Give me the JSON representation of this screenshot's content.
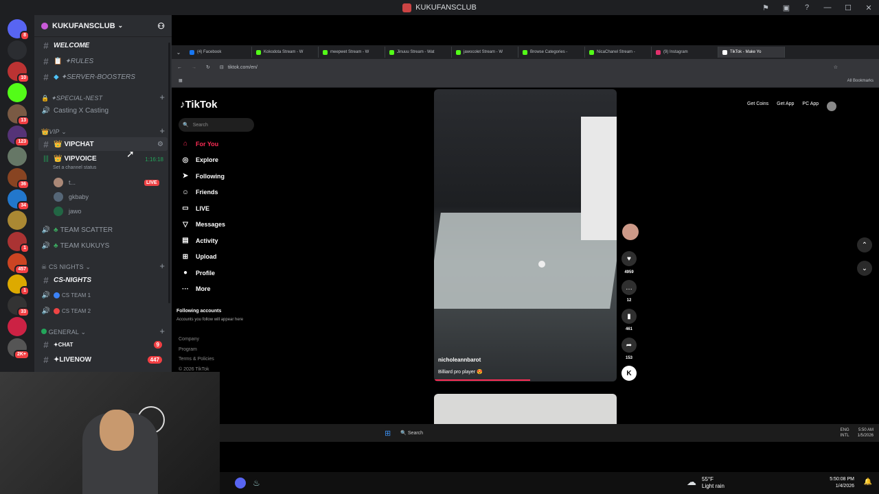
{
  "window": {
    "title": "KUKUFANSCLUB"
  },
  "server": {
    "name": "KUKUFANSCLUB"
  },
  "servers": [
    {
      "badge": "8",
      "color": "#5865f2"
    },
    {
      "badge": "",
      "color": "#2b2d31"
    },
    {
      "badge": "10",
      "color": "#b33"
    },
    {
      "badge": "",
      "color": "#53fc18"
    },
    {
      "badge": "13",
      "color": "#7a5a44"
    },
    {
      "badge": "123",
      "color": "#553377"
    },
    {
      "badge": "",
      "color": "#667766"
    },
    {
      "badge": "36",
      "color": "#884422"
    },
    {
      "badge": "34",
      "color": "#2277cc"
    },
    {
      "badge": "",
      "color": "#aa8833"
    },
    {
      "badge": "1",
      "color": "#aa3333"
    },
    {
      "badge": "457",
      "color": "#cc4422"
    },
    {
      "badge": "1",
      "color": "#ddaa00"
    },
    {
      "badge": "33",
      "color": "#333333"
    },
    {
      "badge": "",
      "color": "#cc2244"
    },
    {
      "badge": "2K+",
      "color": "#555555"
    }
  ],
  "channels": {
    "welcome": "WELCOME",
    "rules": "✦RULES",
    "boosters": "✦SERVER-BOOSTERS",
    "special_nest": "✦Special-Nest",
    "casting": "Casting X Casting",
    "vip_cat": "VIP",
    "vipchat": "VIPCHAT",
    "vipvoice": "VIPVOICE",
    "vipvoice_time": "1:16:18",
    "vipvoice_status": "Set a channel status",
    "users": [
      {
        "name": "t...",
        "live": "LIVE",
        "color": "#aa8877"
      },
      {
        "name": "gkbaby",
        "live": "",
        "color": "#556677"
      },
      {
        "name": "jawo",
        "live": "",
        "color": "#226644"
      }
    ],
    "team_scatter": "TEAM SCATTER",
    "team_kukuys": "TEAM KUKUYS",
    "cs_cat": "CS NIGHTS",
    "cs_nights": "CS-NIGHTS",
    "cs_team1": "CS TEAM 1",
    "cs_team2": "CS TEAM 2",
    "general_cat": "GENERAL",
    "chat": "✦CHAT",
    "chat_badge": "9",
    "livenow": "✦LIVENOW",
    "livenow_badge": "447"
  },
  "browser": {
    "tabs": [
      {
        "label": "(4) Facebook",
        "color": "#1877f2"
      },
      {
        "label": "Kokodota Stream - W",
        "color": "#53fc18"
      },
      {
        "label": "meepwet Stream - W",
        "color": "#53fc18"
      },
      {
        "label": "Jinuuu Stream - Wat",
        "color": "#53fc18"
      },
      {
        "label": "jawocolet Stream - W",
        "color": "#53fc18"
      },
      {
        "label": "Browse Categories -",
        "color": "#53fc18"
      },
      {
        "label": "NicaChanel Stream -",
        "color": "#53fc18"
      },
      {
        "label": "(9) Instagram",
        "color": "#e1306c"
      },
      {
        "label": "TikTok - Make Yo",
        "color": "#ffffff"
      }
    ],
    "url": "tiktok.com/en/",
    "all_bookmarks": "All Bookmarks"
  },
  "tiktok": {
    "logo": "TikTok",
    "search_placeholder": "Search",
    "nav": [
      {
        "label": "For You",
        "icon": "home-icon",
        "glyph": "⌂",
        "active": true
      },
      {
        "label": "Explore",
        "icon": "compass-icon",
        "glyph": "◎",
        "active": false
      },
      {
        "label": "Following",
        "icon": "following-icon",
        "glyph": "➤",
        "active": false
      },
      {
        "label": "Friends",
        "icon": "friends-icon",
        "glyph": "☺",
        "active": false
      },
      {
        "label": "LIVE",
        "icon": "live-icon",
        "glyph": "▭",
        "active": false
      },
      {
        "label": "Messages",
        "icon": "messages-icon",
        "glyph": "▽",
        "active": false
      },
      {
        "label": "Activity",
        "icon": "activity-icon",
        "glyph": "▤",
        "active": false
      },
      {
        "label": "Upload",
        "icon": "upload-icon",
        "glyph": "⊞",
        "active": false
      },
      {
        "label": "Profile",
        "icon": "profile-icon",
        "glyph": "●",
        "active": false
      },
      {
        "label": "More",
        "icon": "more-icon",
        "glyph": "···",
        "active": false
      }
    ],
    "following_title": "Following accounts",
    "following_sub": "Accounts you follow will appear here",
    "footer": [
      "Company",
      "Program",
      "Terms & Policies",
      "© 2026 TikTok"
    ],
    "get_coins": "Get Coins",
    "get_app": "Get App",
    "pc_app": "PC App",
    "video": {
      "author": "nicholeannbarot",
      "caption": "Billiard pro player 😍"
    },
    "likes": "4959",
    "comments": "12",
    "saves": "461",
    "shares": "153"
  },
  "inner_taskbar": {
    "search": "Search",
    "lang1": "ENG",
    "lang2": "INTL",
    "time": "5:50 AM",
    "date": "1/5/2026"
  },
  "outer_taskbar": {
    "temp": "55°F",
    "weather": "Light rain",
    "time": "5:50:08 PM",
    "date": "1/4/2026"
  }
}
